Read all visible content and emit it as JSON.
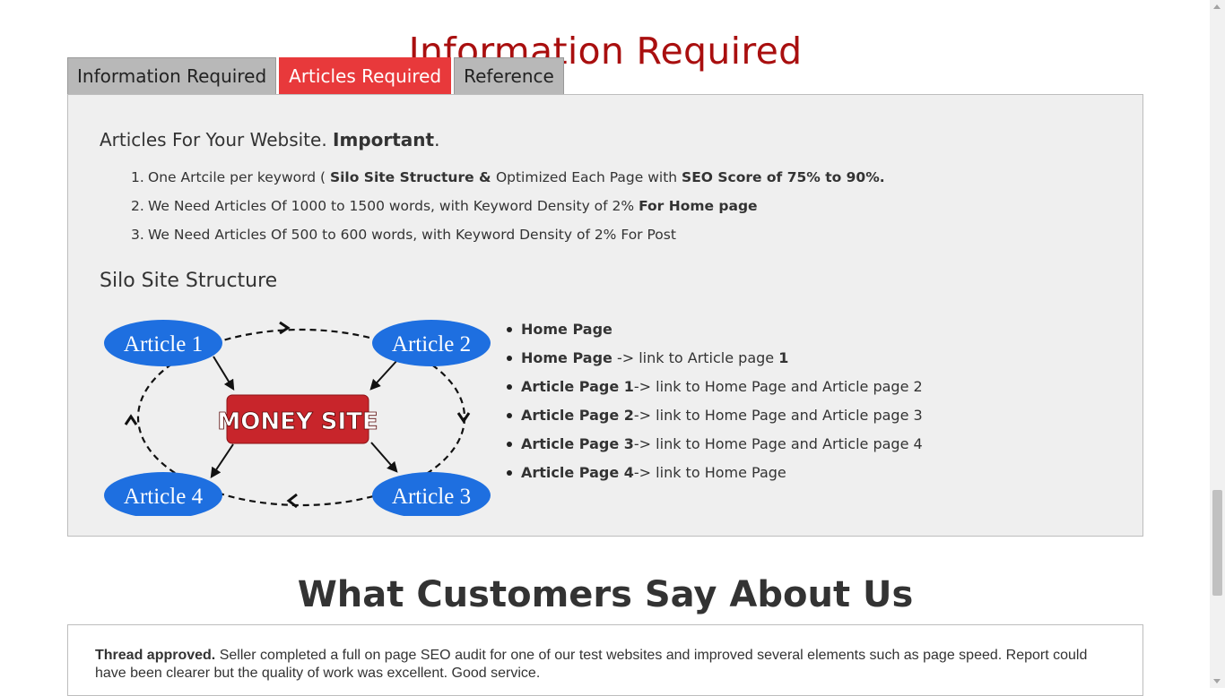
{
  "page_title": "Information Required",
  "tabs": [
    {
      "label": "Information Required",
      "active": false
    },
    {
      "label": "Articles Required",
      "active": true
    },
    {
      "label": "Reference",
      "active": false
    }
  ],
  "intro": {
    "prefix": "Articles For Your Website. ",
    "bold": "Important",
    "suffix": "."
  },
  "requirements": [
    {
      "num": "1.",
      "parts": [
        {
          "t": "One Artcile per keyword  ( ",
          "b": false
        },
        {
          "t": "Silo Site Structure & ",
          "b": true
        },
        {
          "t": "Optimized Each Page with ",
          "b": false
        },
        {
          "t": "SEO Score of 75% to 90%.",
          "b": true
        }
      ]
    },
    {
      "num": "2.",
      "parts": [
        {
          "t": "We Need Articles Of 1000 to 1500 words, with Keyword Density of 2% ",
          "b": false
        },
        {
          "t": "For Home page",
          "b": true
        }
      ]
    },
    {
      "num": "3.",
      "parts": [
        {
          "t": "We Need Articles Of 500 to 600 words, with Keyword Density of 2% For Post",
          "b": false
        }
      ]
    }
  ],
  "silo_title": "Silo Site Structure",
  "diagram": {
    "center": "MONEY SITE",
    "articles": [
      "Article 1",
      "Article 2",
      "Article 3",
      "Article 4"
    ],
    "colors": {
      "ellipse": "#1e6fe0",
      "center": "#c8252b"
    }
  },
  "link_structure": [
    [
      {
        "t": "Home Page",
        "b": true
      }
    ],
    [
      {
        "t": "Home Page",
        "b": true
      },
      {
        "t": " ->  link to Article page ",
        "b": false
      },
      {
        "t": "1",
        "b": true
      }
    ],
    [
      {
        "t": "Article Page 1",
        "b": true
      },
      {
        "t": "-> link to Home Page and Article page 2",
        "b": false
      }
    ],
    [
      {
        "t": "Article Page 2",
        "b": true
      },
      {
        "t": "-> link to Home Page and Article page 3",
        "b": false
      }
    ],
    [
      {
        "t": "Article Page 3",
        "b": true
      },
      {
        "t": "-> link to Home Page and Article page 4",
        "b": false
      }
    ],
    [
      {
        "t": "Article Page 4",
        "b": true
      },
      {
        "t": "-> link to Home Page",
        "b": false
      }
    ]
  ],
  "testimonials_title": "What Customers Say About Us",
  "review": {
    "bold": "Thread approved.",
    "text": " Seller completed a full on page SEO audit for one of our test websites and improved several elements such as page speed. Report could have been clearer but the quality of work was excellent. Good service."
  },
  "colors": {
    "title": "#a90f0f",
    "active_tab": "#e8393b",
    "tab": "#b8b8b8",
    "panel": "#efefef"
  }
}
